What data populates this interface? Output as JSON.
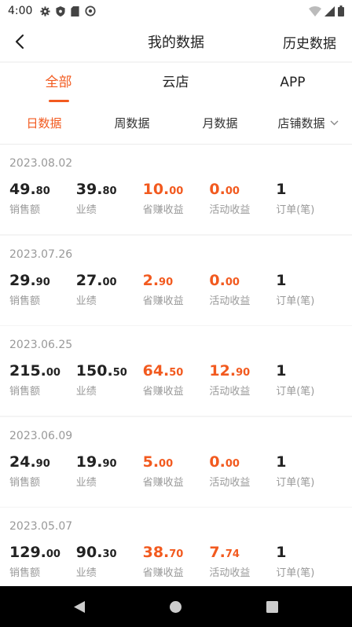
{
  "status_bar": {
    "time": "4:00"
  },
  "header": {
    "title": "我的数据",
    "history_label": "历史数据"
  },
  "tabs": [
    {
      "label": "全部",
      "active": true
    },
    {
      "label": "云店",
      "active": false
    },
    {
      "label": "APP",
      "active": false
    }
  ],
  "filters": [
    {
      "label": "日数据",
      "active": true
    },
    {
      "label": "周数据",
      "active": false
    },
    {
      "label": "月数据",
      "active": false
    },
    {
      "label": "店铺数据",
      "active": false
    }
  ],
  "metric_labels": [
    "销售额",
    "业绩",
    "省赚收益",
    "活动收益",
    "订单(笔)"
  ],
  "records": [
    {
      "date": "2023.08.02",
      "sales": [
        "49.",
        "80"
      ],
      "performance": [
        "39.",
        "80"
      ],
      "save_earn": [
        "10.",
        "00"
      ],
      "activity": [
        "0.",
        "00"
      ],
      "orders": "1"
    },
    {
      "date": "2023.07.26",
      "sales": [
        "29.",
        "90"
      ],
      "performance": [
        "27.",
        "00"
      ],
      "save_earn": [
        "2.",
        "90"
      ],
      "activity": [
        "0.",
        "00"
      ],
      "orders": "1"
    },
    {
      "date": "2023.06.25",
      "sales": [
        "215.",
        "00"
      ],
      "performance": [
        "150.",
        "50"
      ],
      "save_earn": [
        "64.",
        "50"
      ],
      "activity": [
        "12.",
        "90"
      ],
      "orders": "1"
    },
    {
      "date": "2023.06.09",
      "sales": [
        "24.",
        "90"
      ],
      "performance": [
        "19.",
        "90"
      ],
      "save_earn": [
        "5.",
        "00"
      ],
      "activity": [
        "0.",
        "00"
      ],
      "orders": "1"
    },
    {
      "date": "2023.05.07",
      "sales": [
        "129.",
        "00"
      ],
      "performance": [
        "90.",
        "30"
      ],
      "save_earn": [
        "38.",
        "70"
      ],
      "activity": [
        "7.",
        "74"
      ],
      "orders": "1"
    }
  ],
  "colors": {
    "accent": "#f25a1f",
    "text": "#222222",
    "muted": "#999999"
  }
}
